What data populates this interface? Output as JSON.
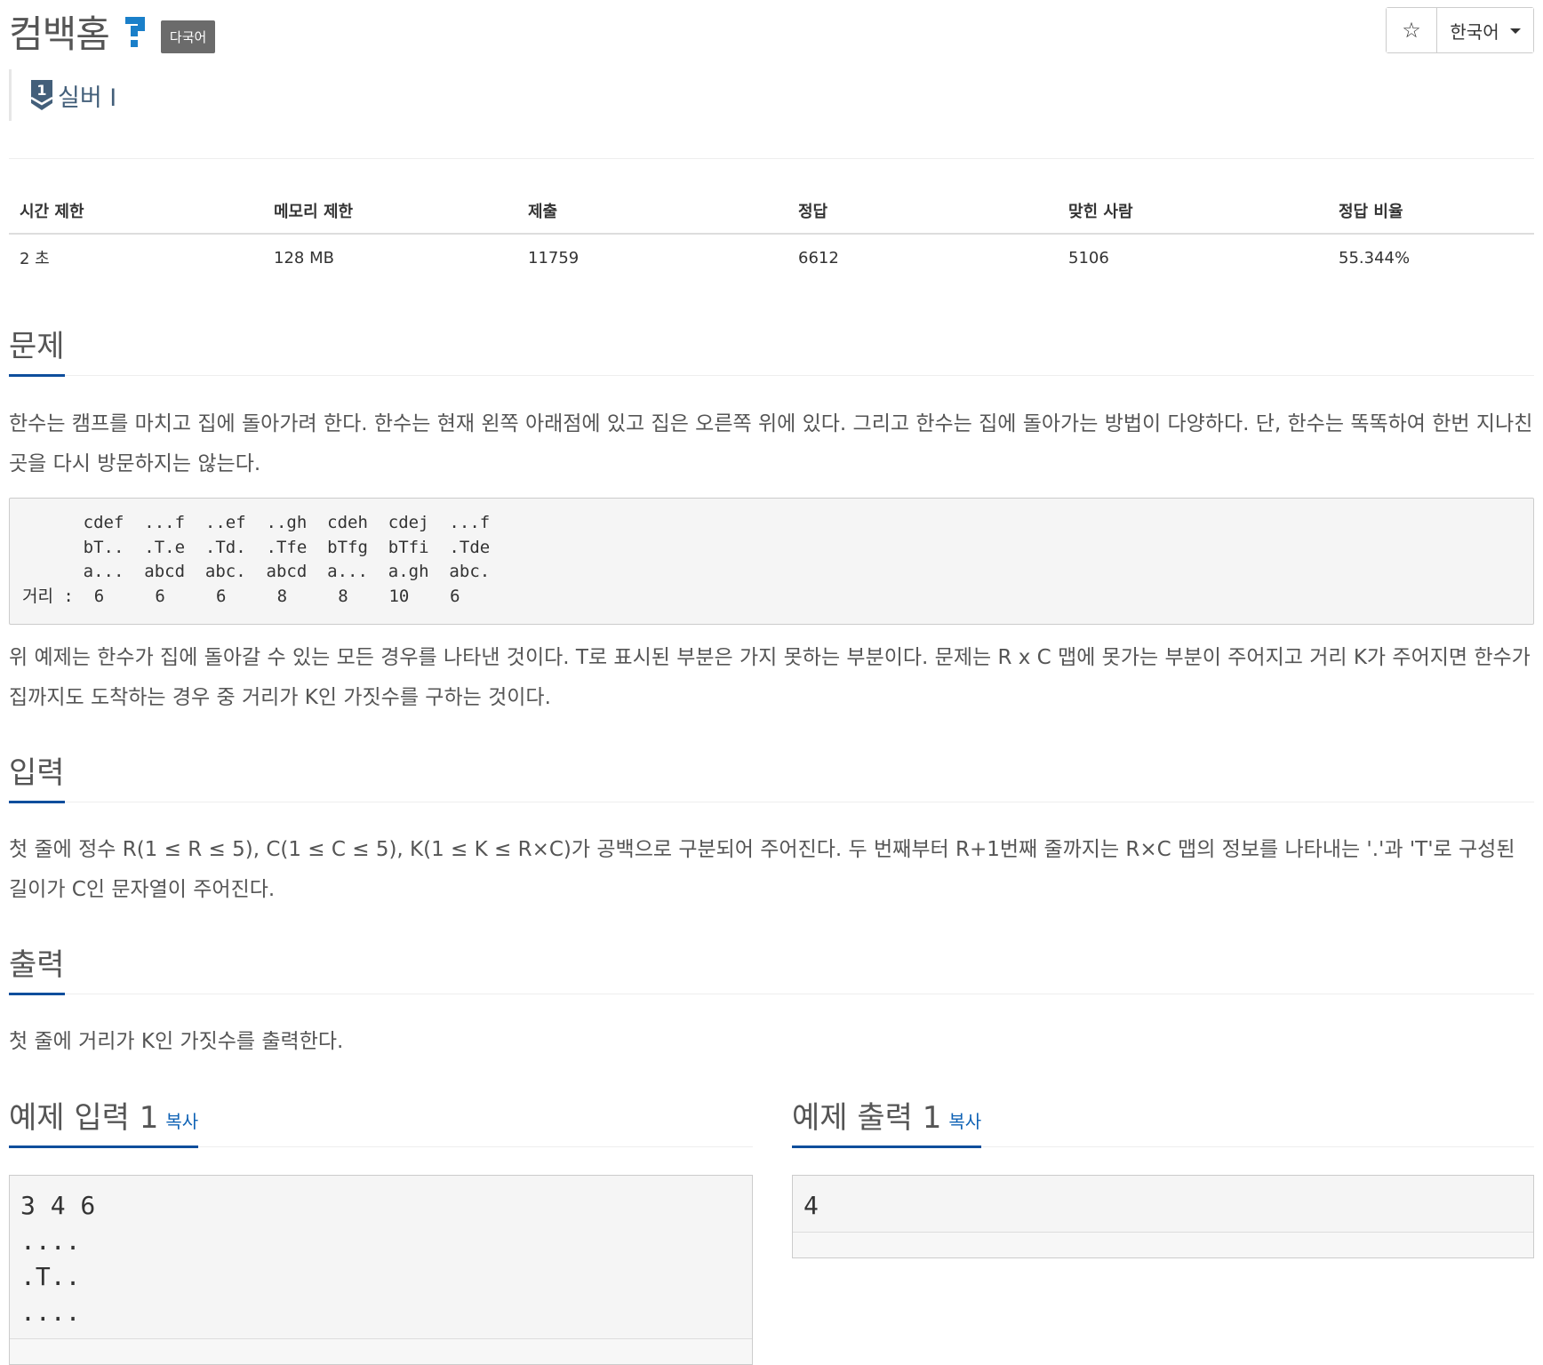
{
  "header": {
    "title": "컴백홈",
    "lang_badge": "다국어",
    "tier_label": "실버 I",
    "star_glyph": "☆",
    "language_select": "한국어"
  },
  "info_table": {
    "headers": [
      "시간 제한",
      "메모리 제한",
      "제출",
      "정답",
      "맞힌 사람",
      "정답 비율"
    ],
    "values": [
      "2 초",
      "128 MB",
      "11759",
      "6612",
      "5106",
      "55.344%"
    ]
  },
  "problem": {
    "title": "문제",
    "para1": "한수는 캠프를 마치고 집에 돌아가려 한다. 한수는 현재 왼쪽 아래점에 있고 집은 오른쪽 위에 있다. 그리고 한수는 집에 돌아가는 방법이 다양하다. 단, 한수는 똑똑하여 한번 지나친 곳을 다시 방문하지는 않는다.",
    "code": "      cdef  ...f  ..ef  ..gh  cdeh  cdej  ...f\n      bT..  .T.e  .Td.  .Tfe  bTfg  bTfi  .Tde\n      a...  abcd  abc.  abcd  a...  a.gh  abc.\n거리 :  6     6     6     8     8    10    6",
    "para2": "위 예제는 한수가 집에 돌아갈 수 있는 모든 경우를 나타낸 것이다. T로 표시된 부분은 가지 못하는 부분이다. 문제는 R x C 맵에 못가는 부분이 주어지고 거리 K가 주어지면 한수가 집까지도 도착하는 경우 중 거리가 K인 가짓수를 구하는 것이다."
  },
  "input": {
    "title": "입력",
    "text": "첫 줄에 정수 R(1 ≤ R ≤ 5), C(1 ≤ C ≤ 5), K(1 ≤ K ≤ R×C)가 공백으로 구분되어 주어진다. 두 번째부터 R+1번째 줄까지는 R×C 맵의 정보를 나타내는 '.'과 'T'로 구성된 길이가 C인 문자열이 주어진다."
  },
  "output": {
    "title": "출력",
    "text": "첫 줄에 거리가 K인 가짓수를 출력한다."
  },
  "examples": {
    "input_title": "예제 입력 1",
    "output_title": "예제 출력 1",
    "copy_label": "복사",
    "input_value": "3 4 6\n....\n.T..\n....",
    "output_value": "4"
  },
  "colors": {
    "accent": "#0e4e9c",
    "link": "#0e62b5",
    "tier": "#435f7a"
  }
}
